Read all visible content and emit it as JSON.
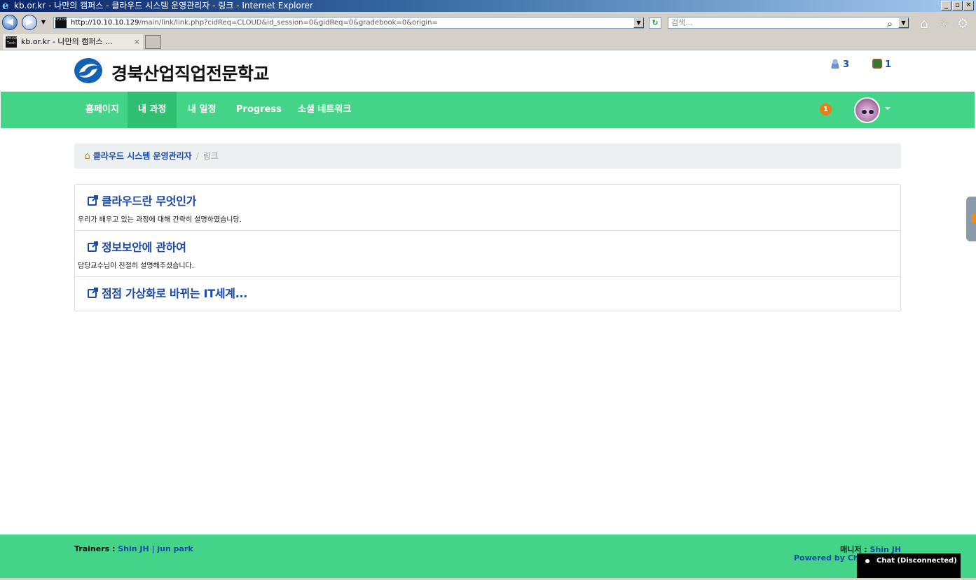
{
  "browser": {
    "window_title": "kb.or.kr - 나만의 캠퍼스 - 클라우드 시스템 운영관리자 - 링크 - Internet Explorer",
    "url_host": "http://10.10.10.129",
    "url_path": "/main/link/link.php?cidReq=CLOUD&id_session=0&gidReq=0&gradebook=0&origin=",
    "search_placeholder": "검색...",
    "tab_title": "kb.or.kr - 나만의 캠퍼스 ...",
    "tab_close": "×",
    "favicon_text": "Unicen Tech",
    "min_btn": "_",
    "max_btn": "▫",
    "close_btn": "✕",
    "back_glyph": "◀",
    "forward_glyph": "▶",
    "dropdown_glyph": "▼",
    "refresh_glyph": "↻",
    "search_glyph": "⌕",
    "home_glyph": "⌂",
    "favorites_glyph": "☆",
    "tools_glyph": "⚙"
  },
  "header": {
    "school_name": "경북산업직업전문학교",
    "users_count": "3",
    "courses_count": "1"
  },
  "nav": {
    "items": [
      {
        "label": "홈페이지"
      },
      {
        "label": "내 과정"
      },
      {
        "label": "내 일정"
      },
      {
        "label": "Progress"
      },
      {
        "label": "소셜 네트워크"
      }
    ],
    "active_index": 1,
    "notification_count": "1"
  },
  "breadcrumb": {
    "home_glyph": "⌂",
    "course": "클라우드 시스템 운영관리자",
    "separator": "/",
    "current": "링크"
  },
  "links": [
    {
      "title": "클라우드란 무엇인가",
      "description": "우리가 배우고 있는 과정에 대해 간략히 설명하였습니당."
    },
    {
      "title": "정보보안에 관하여",
      "description": "담당교수님이 친절히 설명해주셨습니다."
    },
    {
      "title": "점점 가상화로 바뀌는 IT세계...",
      "description": ""
    }
  ],
  "footer": {
    "trainers_label": "Trainers : ",
    "trainers_names": "Shin JH | jun park",
    "manager_label": "매니저 : ",
    "manager_name": "Shin JH",
    "powered_by": "Powered by Cha"
  },
  "chat": {
    "label": "Chat (Disconnected)"
  },
  "colors": {
    "brand_green": "#44d488",
    "brand_green_active": "#2fbf70",
    "link_blue": "#1b49a8",
    "notification_orange": "#f07b10"
  }
}
